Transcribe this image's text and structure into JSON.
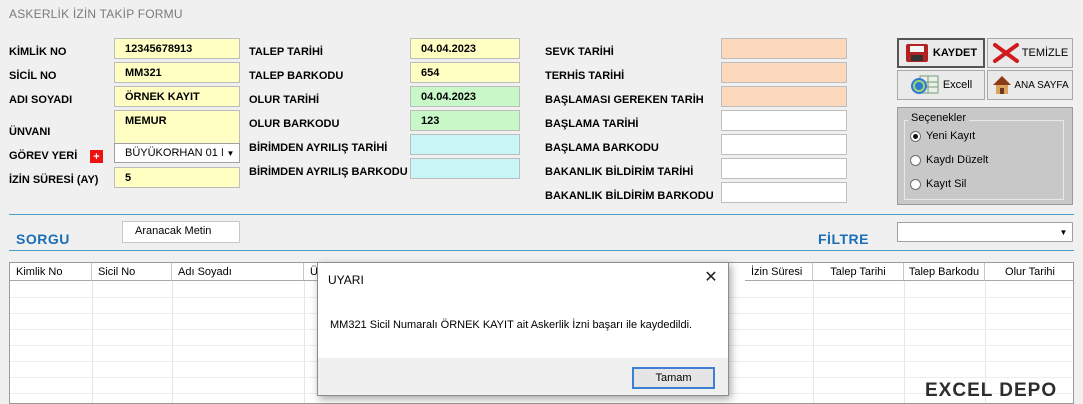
{
  "form": {
    "title": "ASKERLİK İZİN TAKİP FORMU"
  },
  "left": {
    "kimlik_label": "KİMLİK NO",
    "kimlik_value": "12345678913",
    "sicil_label": "SİCİL NO",
    "sicil_value": "MM321",
    "adsoyad_label": "ADI SOYADI",
    "adsoyad_value": "ÖRNEK KAYIT",
    "unvan_label": "ÜNVANI",
    "unvan_value": "MEMUR",
    "gorev_label": "GÖREV YERİ",
    "gorev_plus": "+",
    "gorev_value": "BÜYÜKORHAN 01 NC",
    "izin_label": "İZİN  SÜRESİ (AY)",
    "izin_value": "5"
  },
  "middle": {
    "talep_tarihi_label": "TALEP TARİHİ",
    "talep_tarihi_value": "04.04.2023",
    "talep_barkodu_label": "TALEP BARKODU",
    "talep_barkodu_value": "654",
    "olur_tarihi_label": "OLUR TARİHİ",
    "olur_tarihi_value": "04.04.2023",
    "olur_barkodu_label": "OLUR BARKODU",
    "olur_barkodu_value": "123",
    "birim_tarih_label": "BİRİMDEN AYRILIŞ TARİHİ",
    "birim_barkod_label": "BİRİMDEN AYRILIŞ BARKODU"
  },
  "right": {
    "sevk_label": "SEVK TARİHİ",
    "terhis_label": "TERHİS TARİHİ",
    "baslamasi_label": "BAŞLAMASI GEREKEN TARİH",
    "baslama_tarihi_label": "BAŞLAMA TARİHİ",
    "baslama_barkodu_label": "BAŞLAMA BARKODU",
    "bakanlik_tarih_label": "BAKANLIK BİLDİRİM TARİHİ",
    "bakanlik_barkod_label": "BAKANLIK BİLDİRİM BARKODU"
  },
  "buttons": {
    "kaydet": "KAYDET",
    "temizle": "TEMİZLE",
    "excel": "Excell",
    "anasayfa": "ANA SAYFA"
  },
  "options": {
    "title": "Seçenekler",
    "items": [
      "Yeni Kayıt",
      "Kaydı Düzelt",
      "Kayıt Sil"
    ],
    "selected": 0
  },
  "query": {
    "sorgu_label": "SORGU",
    "search_value": "Aranacak Metin",
    "filtre_label": "FİLTRE",
    "filtre_value": ""
  },
  "grid": {
    "columns": [
      "Kimlik No",
      "Sicil No",
      "Adı Soyadı",
      "Ü",
      "İzin Süresi",
      "Talep Tarihi",
      "Talep Barkodu",
      "Olur Tarihi"
    ]
  },
  "dialog": {
    "title": "UYARI",
    "close": "✕",
    "message": "MM321 Sicil Numaralı ÖRNEK KAYIT ait  Askerlik İzni başarı ile kaydedildi.",
    "ok_label": "Tamam"
  },
  "watermark": {
    "text": "EXCEL DEPO"
  },
  "colors": {
    "accent": "#1a6fb6",
    "yellow_field": "#ffffc4",
    "green_field": "#c8f7c8",
    "cyan_field": "#c8f5f5",
    "peach_field": "#fcd9bd"
  },
  "icons": [
    "save-icon",
    "delete-x-icon",
    "excel-icon",
    "home-icon",
    "dropdown-arrow-icon",
    "close-icon"
  ]
}
